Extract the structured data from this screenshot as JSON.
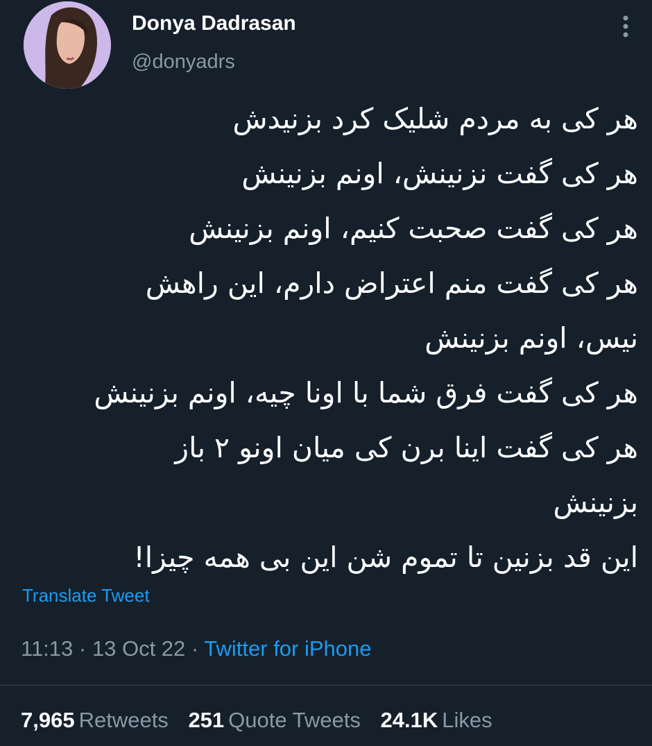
{
  "user": {
    "display_name": "Donya Dadrasan",
    "handle": "@donyadrs"
  },
  "tweet": {
    "lines": [
      "هر کی به مردم شلیک کرد بزنیدش",
      "هر کی گفت نزنینش، اونم بزنینش",
      "هر کی گفت صحبت کنیم، اونم بزنینش",
      "هر کی گفت منم اعتراض دارم، این راهش",
      "نیس، اونم بزنینش",
      "هر کی گفت فرق شما با اونا چیه، اونم بزنینش",
      "هر کی گفت اینا برن کی میان اونو ۲ باز",
      "بزنینش",
      "این قد بزنین تا تموم شن این بی همه چیزا!"
    ],
    "translate_label": "Translate Tweet",
    "time": "11:13",
    "date": "13 Oct 22",
    "separator": "·",
    "source": "Twitter for iPhone"
  },
  "stats": {
    "retweets_count": "7,965",
    "retweets_label": "Retweets",
    "quotes_count": "251",
    "quotes_label": "Quote Tweets",
    "likes_count": "24.1K",
    "likes_label": "Likes"
  },
  "colors": {
    "background": "#15202b",
    "accent": "#1d9bf0",
    "secondary_text": "#8b98a5"
  },
  "icons": {
    "more": "more-vertical-icon"
  }
}
